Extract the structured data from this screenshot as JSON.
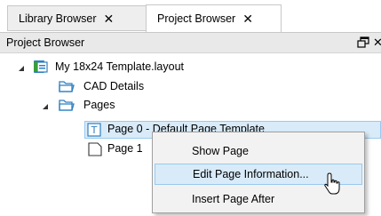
{
  "tabs": [
    {
      "label": "Library Browser",
      "close": "✕"
    },
    {
      "label": "Project Browser",
      "close": "✕"
    }
  ],
  "panel": {
    "title": "Project Browser",
    "close": "✕"
  },
  "tree": {
    "root": "My 18x24 Template.layout",
    "cad_details": "CAD Details",
    "pages": "Pages",
    "page0": "Page 0 - Default Page Template",
    "page1": "Page 1"
  },
  "menu": {
    "items": [
      "Show Page",
      "Edit Page Information...",
      "Insert Page After"
    ]
  },
  "colors": {
    "selection": "#d9ebf9",
    "selection_border": "#99c9ef",
    "folder": "#2f7fc1"
  }
}
